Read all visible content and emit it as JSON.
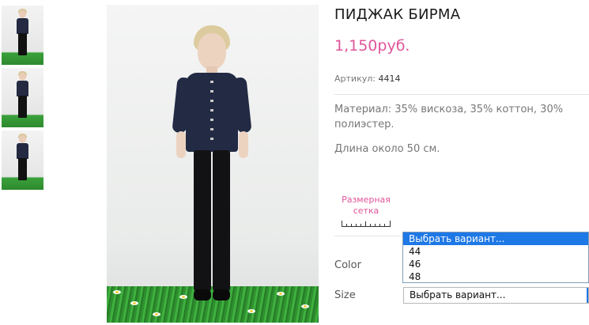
{
  "product": {
    "title": "ПИДЖАК БИРМА",
    "price": "1,150руб.",
    "sku_label": "Артикул:",
    "sku_value": "4414",
    "description": "Материал: 35% вискоза, 35% коттон, 30% полиэстер.",
    "length_note": "Длина около 50 см."
  },
  "size_chart": {
    "label_line1": "Размерная",
    "label_line2": "сетка"
  },
  "options": {
    "color_label": "Color",
    "size_label": "Size",
    "color_dropdown": {
      "items": [
        "Выбрать вариант...",
        "44",
        "46",
        "48"
      ],
      "highlighted_index": 0
    },
    "size_select_value": "Выбрать вариант..."
  },
  "colors": {
    "accent_pink": "#e0559a",
    "highlight_blue": "#1e78e6"
  }
}
